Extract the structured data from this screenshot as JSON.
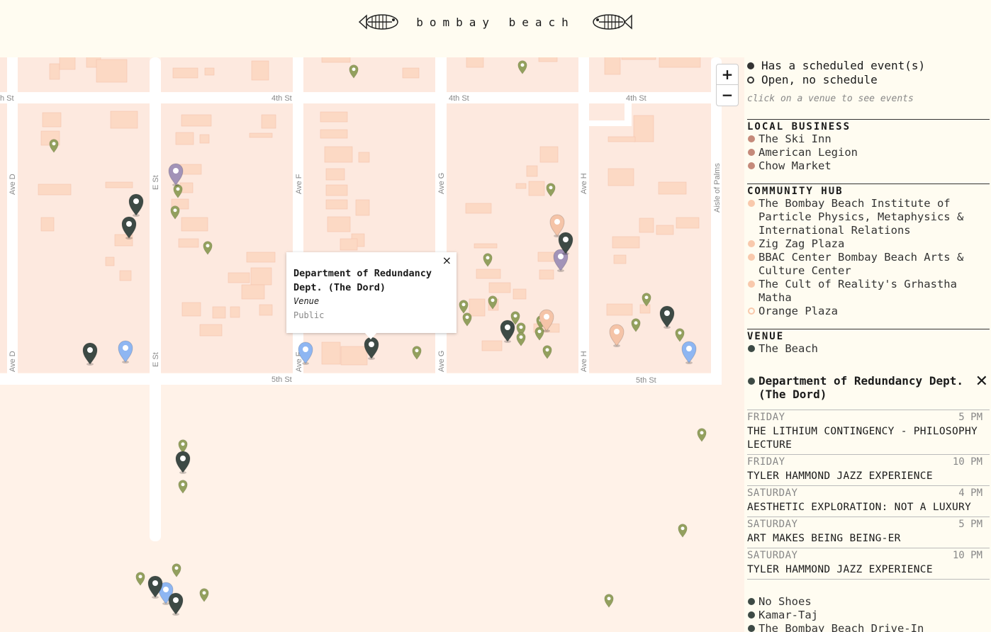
{
  "header": {
    "title": "bombay beach",
    "logo_left": "fish-skeleton-icon",
    "logo_right": "fish-skeleton-icon"
  },
  "map": {
    "zoom_in": "+",
    "zoom_out": "−",
    "colors": {
      "land": "#fff2e8",
      "block": "#fde9df",
      "building": "#fcd9c4",
      "road": "#ffffff",
      "label": "#888888"
    },
    "street_labels": {
      "fourth_st": "4th St",
      "fourth_st_cut": "h St",
      "fifth_st": "5th St",
      "ave_d": "Ave D",
      "e_st": "E St",
      "ave_f": "Ave F",
      "ave_g": "Ave G",
      "ave_h": "Ave H",
      "aisle": "Aisle of Palms"
    },
    "popup": {
      "close": "×",
      "title": "Department of Redundancy Dept. (The Dord)",
      "type": "Venue",
      "access": "Public"
    },
    "marker_colors": {
      "venue": "#3d4a45",
      "small": "#93a05e",
      "purple": "#a293b8",
      "peach": "#f5c4a8",
      "blue": "#8eb6f2"
    }
  },
  "panel": {
    "legend": {
      "scheduled": "Has a scheduled event(s)",
      "open": "Open, no schedule",
      "hint": "click on a venue to see events"
    },
    "local_business": {
      "title": "LOCAL BUSINESS",
      "color": "#c58a7a",
      "items": [
        "The Ski Inn",
        "American Legion",
        "Chow Market"
      ]
    },
    "community_hub": {
      "title": "COMMUNITY HUB",
      "color": "#f9c9ac",
      "items": [
        "The Bombay Beach Institute of Particle Physics, Metaphysics & International Relations",
        "Zig Zag Plaza",
        "BBAC Center Bombay Beach Arts & Culture Center",
        "The Cult of Reality's Grhastha Matha"
      ],
      "open_item": "Orange Plaza"
    },
    "venue": {
      "title": "VENUE",
      "color": "#3d4a45",
      "first": "The Beach"
    },
    "selected": {
      "name": "Department of Redundancy Dept. (The Dord)",
      "close": "✕",
      "events": [
        {
          "day": "FRIDAY",
          "time": "5 PM",
          "title": "THE LITHIUM CONTINGENCY - PHILOSOPHY LECTURE"
        },
        {
          "day": "FRIDAY",
          "time": "10 PM",
          "title": "TYLER HAMMOND JAZZ EXPERIENCE"
        },
        {
          "day": "SATURDAY",
          "time": "4 PM",
          "title": "AESTHETIC EXPLORATION: NOT A LUXURY"
        },
        {
          "day": "SATURDAY",
          "time": "5 PM",
          "title": "ART MAKES BEING BEING-ER"
        },
        {
          "day": "SATURDAY",
          "time": "10 PM",
          "title": "TYLER HAMMOND JAZZ EXPERIENCE"
        }
      ]
    },
    "more_venues": [
      "No Shoes",
      "Kamar-Taj",
      "The Bombay Beach Drive-In"
    ]
  }
}
